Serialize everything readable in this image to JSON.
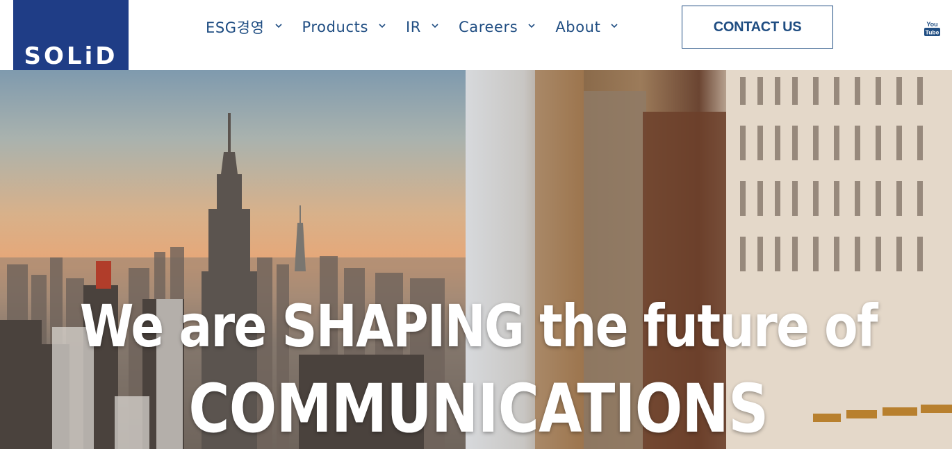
{
  "header": {
    "logo_text": "SOLiD",
    "nav": [
      {
        "label": "ESG경영"
      },
      {
        "label": "Products"
      },
      {
        "label": "IR"
      },
      {
        "label": "Careers"
      },
      {
        "label": "About"
      }
    ],
    "contact_label": "CONTACT US",
    "social_icon": "youtube-icon"
  },
  "hero": {
    "headline_line1": "We are SHAPING the future of",
    "headline_line2": "COMMUNICATIONS"
  },
  "colors": {
    "brand_blue": "#1f3d86",
    "nav_text": "#1f4d82"
  }
}
